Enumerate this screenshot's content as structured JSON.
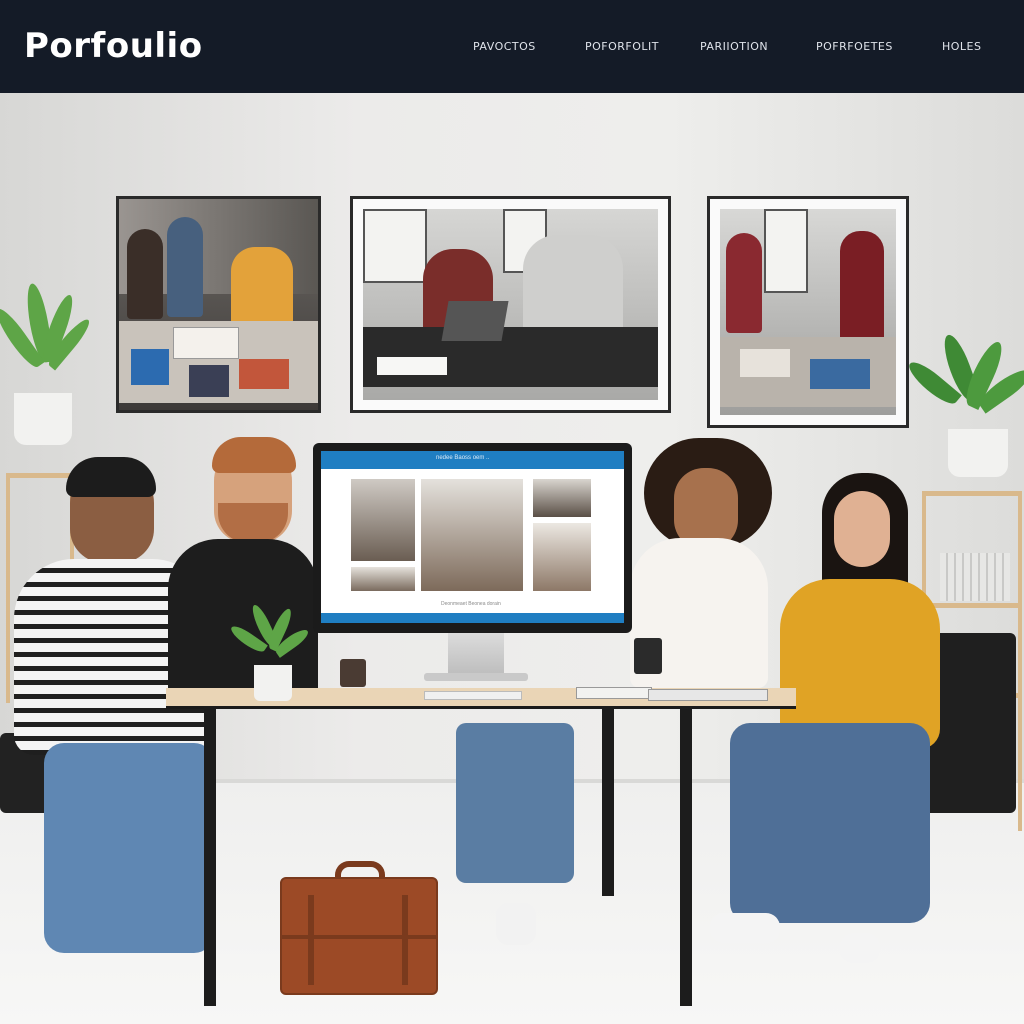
{
  "brand": {
    "logo_text": "Porfoulio"
  },
  "nav": {
    "items": [
      {
        "label": "PAVOCTOS"
      },
      {
        "label": "POFORFOLIT"
      },
      {
        "label": "PARIIOTION"
      },
      {
        "label": "POFRFOETES"
      },
      {
        "label": "HOLES"
      }
    ]
  },
  "monitor": {
    "header_text": "nedee Baoss oem ..",
    "caption_text": "Deonmeaet Beonea dorain"
  },
  "colors": {
    "nav_bg": "#141b27",
    "accent_blue": "#1f7ec2",
    "wall": "#ebebea",
    "desk_wood": "#ead5b6",
    "bag_leather": "#9c4a26",
    "sweater_mustard": "#e0a325"
  }
}
